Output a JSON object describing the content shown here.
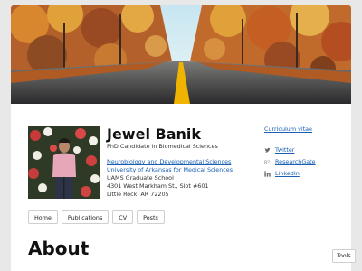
{
  "profile": {
    "name": "Jewel Banik",
    "subtitle": "PhD Candidate in Biomedical Sciences",
    "affiliations": [
      {
        "text": "Neurobiology and Developmental Sciences",
        "link": true
      },
      {
        "text": "University of Arkansas for Medical Sciences",
        "link": true
      },
      {
        "text": "UAMS Graduate School",
        "link": false
      },
      {
        "text": "4301 West Markham St., Slot #601",
        "link": false
      },
      {
        "text": "Little Rock, AR 72205",
        "link": false
      }
    ]
  },
  "sidebar": {
    "cv_link": "Curriculum vitae",
    "social": [
      {
        "label": "Twitter",
        "icon": "twitter-icon"
      },
      {
        "label": "ResearchGate",
        "icon": "researchgate-icon"
      },
      {
        "label": "LinkedIn",
        "icon": "linkedin-icon"
      }
    ]
  },
  "nav": {
    "items": [
      "Home",
      "Publications",
      "CV",
      "Posts"
    ]
  },
  "main": {
    "heading": "About"
  },
  "tools": {
    "label": "Tools"
  },
  "colors": {
    "link": "#1a5fb4",
    "road_line": "#f0b400",
    "foliage": "#d9772a"
  }
}
